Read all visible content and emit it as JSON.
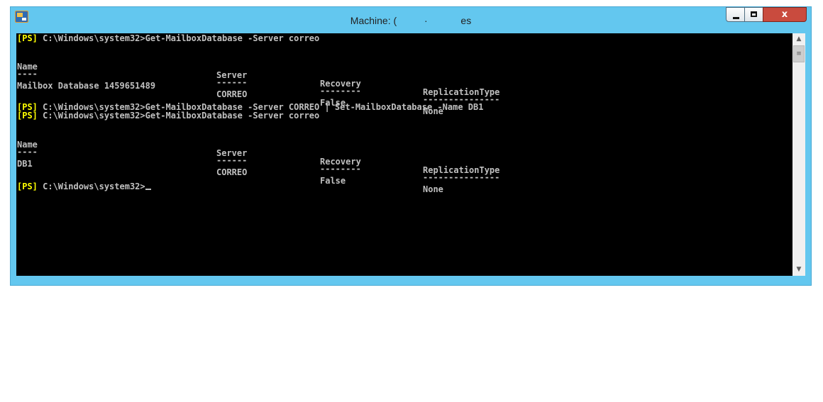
{
  "window": {
    "title_left": "Machine: (",
    "title_mid": "·",
    "title_right": "es",
    "close_label": "x"
  },
  "console": {
    "prompt": "[PS]",
    "lines": {
      "cmd1": " C:\\Windows\\system32>Get-MailboxDatabase -Server correo",
      "cmd2": " C:\\Windows\\system32>Get-MailboxDatabase -Server CORREO | Set-MailboxDatabase -Name DB1",
      "cmd3": " C:\\Windows\\system32>Get-MailboxDatabase -Server correo",
      "cmd4": " C:\\Windows\\system32>"
    },
    "table_headers": [
      "Name",
      "Server",
      "Recovery",
      "ReplicationType"
    ],
    "table_underlines": [
      "----",
      "------",
      "--------",
      "---------------"
    ],
    "table1_row": [
      "Mailbox Database 1459651489",
      "CORREO",
      "False",
      "None"
    ],
    "table2_row": [
      "DB1",
      "CORREO",
      "False",
      "None"
    ]
  },
  "scrollbar": {
    "up_glyph": "▲",
    "down_glyph": "▼",
    "thumb_glyph": "≡"
  }
}
